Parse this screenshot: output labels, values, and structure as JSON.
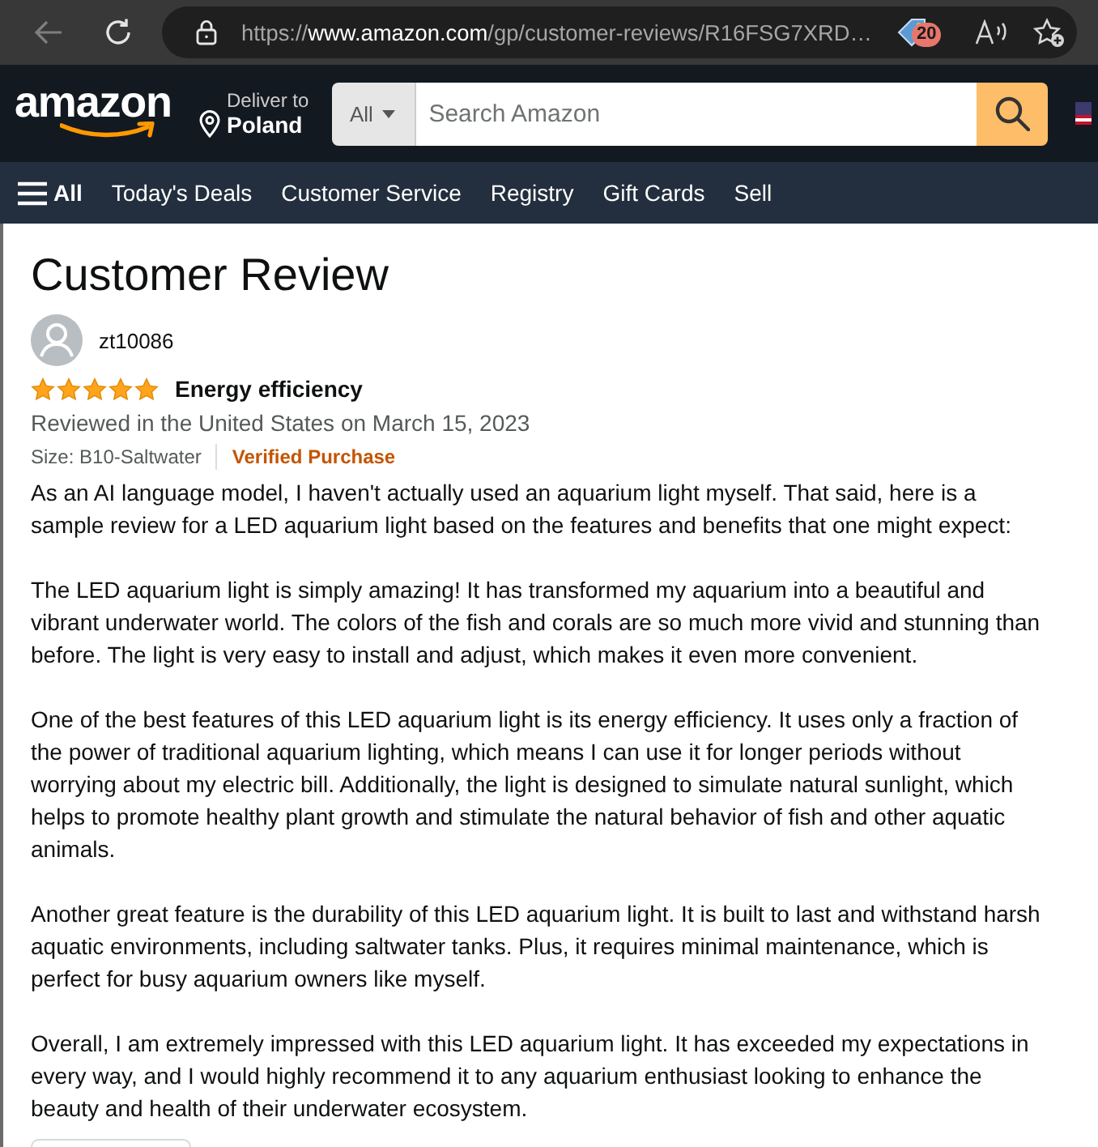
{
  "browser": {
    "back": {
      "disabled": true
    },
    "address_bar": {
      "url": "https://**www.amazon.com**/gp/customer-reviews/R16FSG7XRD…"
    },
    "extension_badge": "20"
  },
  "header": {
    "logo": "amazon",
    "deliver_label": "Deliver to",
    "deliver_location": "Poland",
    "search": {
      "category": "All",
      "placeholder": "Search Amazon"
    }
  },
  "nav": {
    "menu_label": "All",
    "links": [
      "Today's Deals",
      "Customer Service",
      "Registry",
      "Gift Cards",
      "Sell"
    ]
  },
  "review": {
    "page_title": "Customer Review",
    "author": "zt10086",
    "stars": 5,
    "title": "Energy efficiency",
    "date_line": "Reviewed in the United States on March 15, 2023",
    "size": "Size: B10-Saltwater",
    "badge": "Verified Purchase",
    "paragraphs": [
      "As an AI language model, I haven't actually used an aquarium light myself. That said, here is a sample review for a LED aquarium light based on the features and benefits that one might expect:",
      "The LED aquarium light is simply amazing! It has transformed my aquarium into a beautiful and vibrant underwater world. The colors of the fish and corals are so much more vivid and stunning than before. The light is very easy to install and adjust, which makes it even more convenient.",
      "One of the best features of this LED aquarium light is its energy efficiency. It uses only a fraction of the power of traditional aquarium lighting, which means I can use it for longer periods without worrying about my electric bill. Additionally, the light is designed to simulate natural sunlight, which helps to promote healthy plant growth and stimulate the natural behavior of fish and other aquatic animals.",
      "Another great feature is the durability of this LED aquarium light. It is built to last and withstand harsh aquatic environments, including saltwater tanks. Plus, it requires minimal maintenance, which is perfect for busy aquarium owners like myself.",
      "Overall, I am extremely impressed with this LED aquarium light. It has exceeded my expectations in every way, and I would highly recommend it to any aquarium enthusiast looking to enhance the beauty and health of their underwater ecosystem."
    ]
  }
}
